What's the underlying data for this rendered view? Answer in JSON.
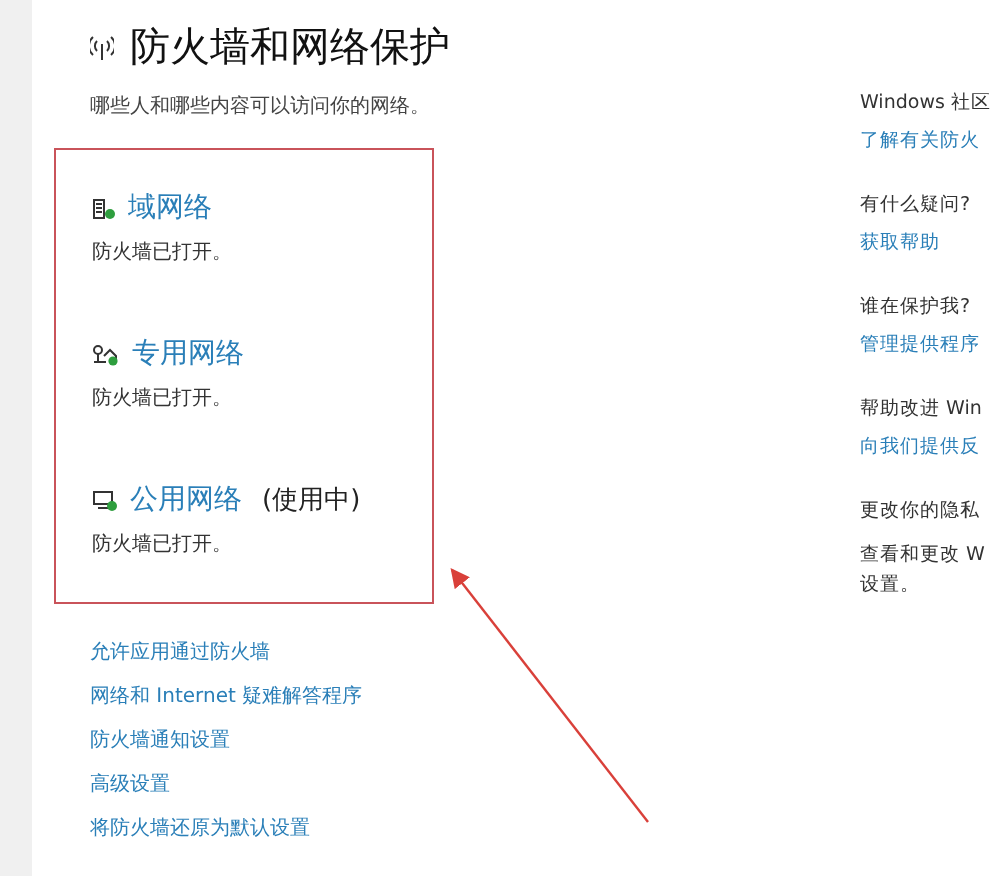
{
  "header": {
    "title": "防火墙和网络保护",
    "subtitle": "哪些人和哪些内容可以访问你的网络。"
  },
  "networks": [
    {
      "kind": "domain",
      "name": "域网络",
      "status": "防火墙已打开。"
    },
    {
      "kind": "private",
      "name": "专用网络",
      "status": "防火墙已打开。"
    },
    {
      "kind": "public",
      "name": "公用网络",
      "in_use": "(使用中)",
      "status": "防火墙已打开。"
    }
  ],
  "links": [
    "允许应用通过防火墙",
    "网络和 Internet 疑难解答程序",
    "防火墙通知设置",
    "高级设置",
    "将防火墙还原为默认设置"
  ],
  "side_sections": [
    {
      "heading": "Windows 社区",
      "link": "了解有关防火"
    },
    {
      "heading": "有什么疑问?",
      "link": "获取帮助"
    },
    {
      "heading": "谁在保护我?",
      "link": "管理提供程序"
    },
    {
      "heading": "帮助改进 Win",
      "link": "向我们提供反"
    },
    {
      "heading": "更改你的隐私",
      "text": "查看和更改 W",
      "text_2": "设置。"
    }
  ]
}
